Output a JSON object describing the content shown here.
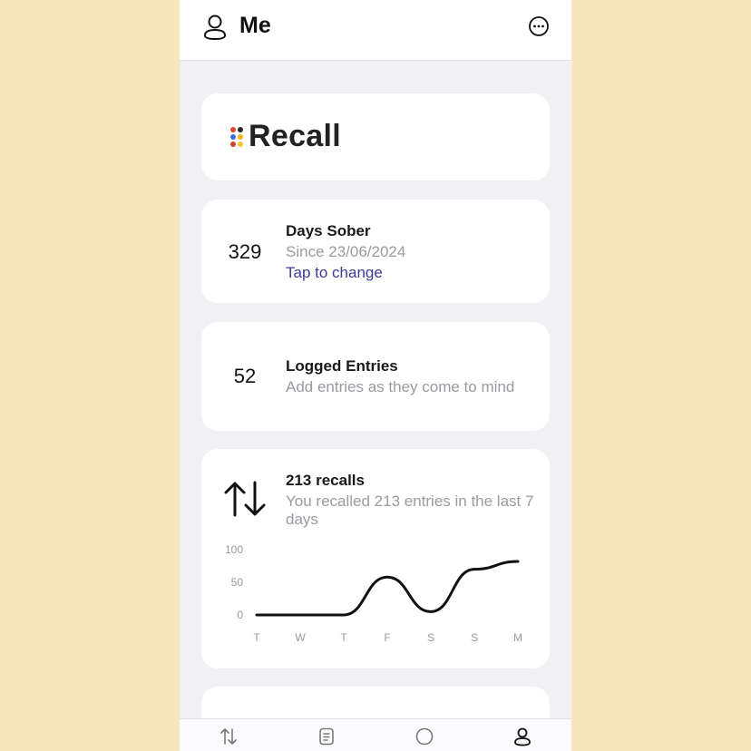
{
  "header": {
    "title": "Me",
    "profile_icon": "person-icon",
    "more_icon": "ellipsis-circle-icon"
  },
  "logo": {
    "text": "Recall",
    "dot_colors": [
      "#e0442c",
      "#3a6fd8",
      "#f2b21c",
      "#2a2a2a",
      "#d1452f",
      "#f5c23a"
    ]
  },
  "days_sober": {
    "count": "329",
    "title": "Days Sober",
    "since": "Since 23/06/2024",
    "link": "Tap to change"
  },
  "logged_entries": {
    "count": "52",
    "title": "Logged Entries",
    "subtitle": "Add entries as they come to mind"
  },
  "recalls": {
    "title": "213 recalls",
    "subtitle": "You recalled 213 entries in the last 7 days",
    "icon": "arrows-up-down-icon"
  },
  "chart_data": {
    "type": "line",
    "categories": [
      "T",
      "W",
      "T",
      "F",
      "S",
      "S",
      "M"
    ],
    "series": [
      {
        "values": [
          0,
          0,
          0,
          58,
          5,
          70,
          82
        ]
      }
    ],
    "ylim": [
      0,
      100
    ],
    "yticks": [
      "100",
      "50",
      "0"
    ],
    "grid": false,
    "color": "#111111"
  },
  "tabbar": {
    "items": [
      "arrows-up-down-icon",
      "document-icon",
      "circle-icon",
      "person-icon"
    ]
  }
}
